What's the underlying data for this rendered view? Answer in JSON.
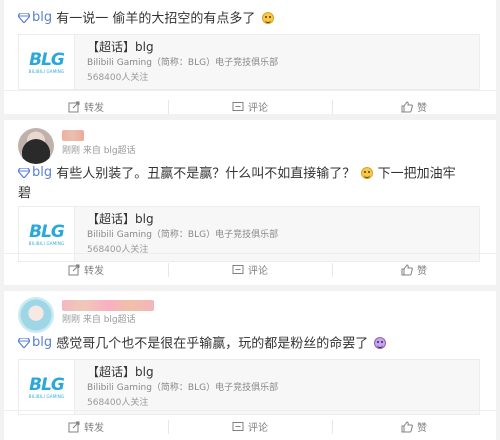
{
  "posts": [
    {
      "topic": "blg",
      "text": "有一说一 偷羊的大招空的有点多了",
      "card": {
        "title": "【超话】blg",
        "desc": "Bilibili Gaming（简称：BLG）电子竞技俱乐部",
        "fans": "568400人关注"
      },
      "actions": {
        "repost": "转发",
        "comment": "评论",
        "like": "赞"
      }
    },
    {
      "meta": "刚刚 来自 blg超话",
      "topic": "blg",
      "text": "有些人别装了。丑赢不是赢？什么叫不如直接输了？",
      "text_tail": "下一把加油牢",
      "text_line2": "碧",
      "card": {
        "title": "【超话】blg",
        "desc": "Bilibili Gaming（简称：BLG）电子竞技俱乐部",
        "fans": "568400人关注"
      },
      "actions": {
        "repost": "转发",
        "comment": "评论",
        "like": "赞"
      }
    },
    {
      "meta": "刚刚 来自 blg超话",
      "topic": "blg",
      "text": "感觉哥几个也不是很在乎输赢，玩的都是粉丝的命罢了",
      "card": {
        "title": "【超话】blg",
        "desc": "Bilibili Gaming（简称：BLG）电子竞技俱乐部",
        "fans": "568400人关注"
      },
      "actions": {
        "repost": "转发",
        "comment": "评论",
        "like": "赞"
      }
    }
  ],
  "logo": {
    "text": "BLG",
    "sub": "BILIBILI GAMING"
  },
  "colors": {
    "topic": "#5a7fd6",
    "logo": "#2aa8d8",
    "background": "#f2f2f2"
  },
  "icons": [
    "diamond-icon",
    "emoji-icon",
    "repost-icon",
    "comment-icon",
    "like-icon"
  ]
}
